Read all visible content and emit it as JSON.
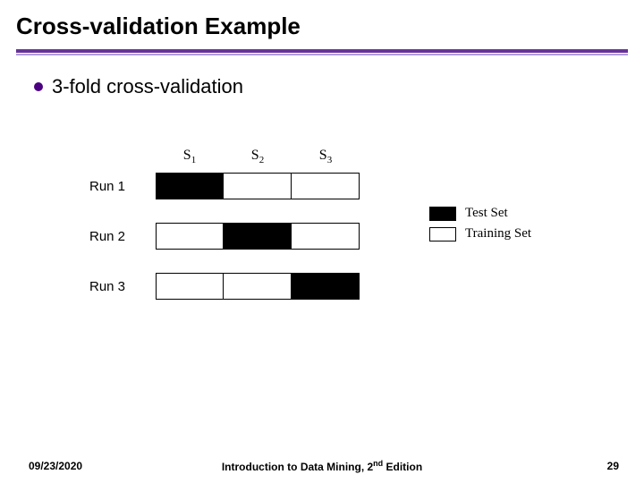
{
  "title": "Cross-validation Example",
  "bullet": "3-fold cross-validation",
  "columns": [
    "S",
    "S",
    "S"
  ],
  "column_subs": [
    "1",
    "2",
    "3"
  ],
  "runs": [
    {
      "label": "Run 1",
      "cells": [
        true,
        false,
        false
      ]
    },
    {
      "label": "Run 2",
      "cells": [
        false,
        true,
        false
      ]
    },
    {
      "label": "Run 3",
      "cells": [
        false,
        false,
        true
      ]
    }
  ],
  "legend": {
    "test": "Test Set",
    "train": "Training Set"
  },
  "footer": {
    "date": "09/23/2020",
    "center_a": "Introduction to Data Mining, 2",
    "center_sup": "nd",
    "center_b": " Edition",
    "page": "29"
  }
}
